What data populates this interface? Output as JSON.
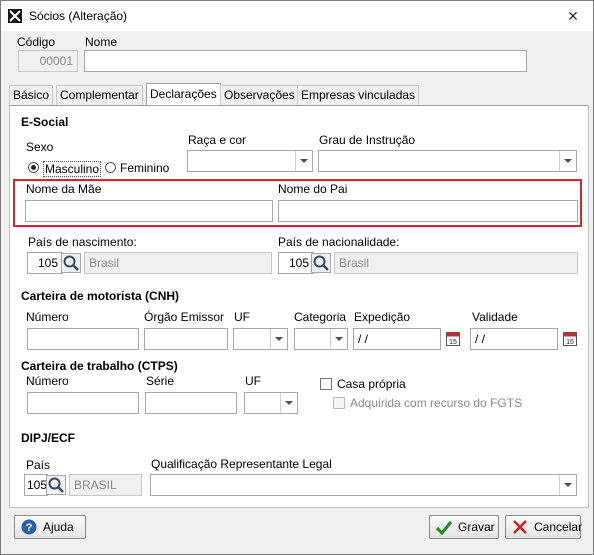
{
  "window": {
    "title": "Sócios (Alteração)",
    "close": "✕"
  },
  "header": {
    "codigo_label": "Código",
    "codigo_value": "00001",
    "nome_label": "Nome",
    "nome_value": ""
  },
  "tabs": [
    {
      "label": "Básico"
    },
    {
      "label": "Complementar"
    },
    {
      "label": "Declarações",
      "active": true
    },
    {
      "label": "Observações"
    },
    {
      "label": "Empresas vinculadas"
    }
  ],
  "esocial": {
    "section": "E-Social",
    "sexo_label": "Sexo",
    "sexo_options": [
      "Masculino",
      "Feminino"
    ],
    "sexo_selected": "Masculino",
    "raca_label": "Raça e cor",
    "raca_value": "",
    "grau_label": "Grau de Instrução",
    "grau_value": "",
    "mae_label": "Nome da Mãe",
    "mae_value": "",
    "pai_label": "Nome do Pai",
    "pai_value": "",
    "nasc_label": "País de nascimento:",
    "nasc_code": "105",
    "nasc_name": "Brasil",
    "nac_label": "País de nacionalidade:",
    "nac_code": "105",
    "nac_name": "Brasil"
  },
  "cnh": {
    "section": "Carteira de motorista (CNH)",
    "numero_label": "Número",
    "orgao_label": "Órgão Emissor",
    "uf_label": "UF",
    "categoria_label": "Categoria",
    "expedicao_label": "Expedição",
    "expedicao_value": "/ /",
    "validade_label": "Validade",
    "validade_value": "/ /"
  },
  "ctps": {
    "section": "Carteira de trabalho (CTPS)",
    "numero_label": "Número",
    "serie_label": "Série",
    "uf_label": "UF",
    "casa_propria_label": "Casa própria",
    "fgts_label": "Adquirida com recurso do FGTS"
  },
  "dipj": {
    "section": "DIPJ/ECF",
    "pais_label": "País",
    "pais_code": "105",
    "pais_name": "BRASIL",
    "qualif_label": "Qualificação Representante Legal",
    "qualif_value": ""
  },
  "buttons": {
    "ajuda": "Ajuda",
    "gravar": "Gravar",
    "cancelar": "Cancelar"
  },
  "colors": {
    "highlight": "#d9232e",
    "gravar_icon": "#1e8c1e",
    "cancelar_icon": "#d42020",
    "ajuda_icon": "#2a5db0"
  }
}
